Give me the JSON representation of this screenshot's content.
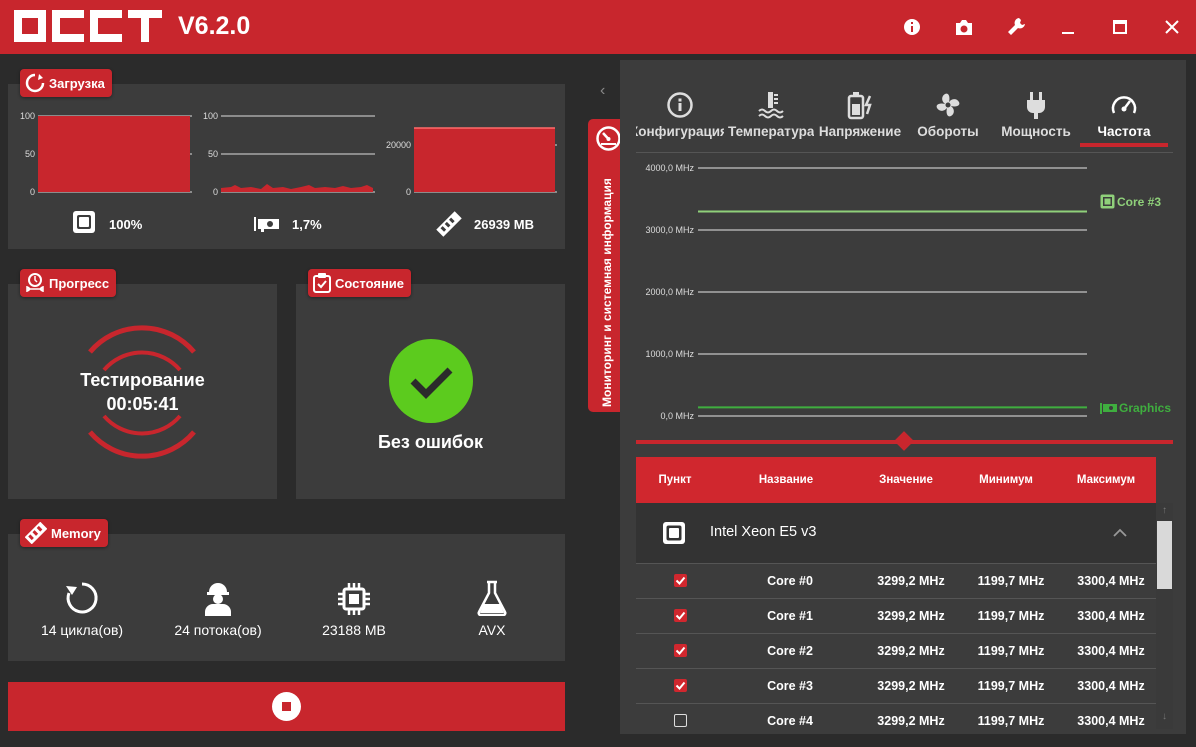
{
  "app": {
    "logo_text": "OCCT",
    "version": "V6.2.0"
  },
  "titlebar": {
    "buttons": [
      "info-icon",
      "camera-icon",
      "wrench-icon",
      "minimize-icon",
      "maximize-icon",
      "close-icon"
    ]
  },
  "load": {
    "title": "Загрузка",
    "cpu": {
      "axis": [
        "100",
        "50",
        "0"
      ],
      "value": "100%"
    },
    "gpu": {
      "axis": [
        "100",
        "50",
        "0"
      ],
      "value": "1,7%"
    },
    "memory": {
      "axis": [
        "20000",
        "0"
      ],
      "value": "26939 MB"
    }
  },
  "progress": {
    "title": "Прогресс",
    "status": "Тестирование",
    "time": "00:05:41"
  },
  "state": {
    "title": "Состояние",
    "status": "Без ошибок"
  },
  "memory": {
    "title": "Memory",
    "items": [
      {
        "icon": "loop-icon",
        "label": "14 цикла(ов)"
      },
      {
        "icon": "worker-icon",
        "label": "24 потока(ов)"
      },
      {
        "icon": "chip-icon",
        "label": "23188 MB"
      },
      {
        "icon": "flask-icon",
        "label": "AVX"
      }
    ]
  },
  "side_tab": {
    "label": "Мониторинг и системная информация"
  },
  "monitor": {
    "tabs": [
      {
        "label": "Конфигурация",
        "icon": "info-icon"
      },
      {
        "label": "Температура",
        "icon": "thermometer-icon"
      },
      {
        "label": "Напряжение",
        "icon": "battery-icon"
      },
      {
        "label": "Обороты",
        "icon": "fan-icon"
      },
      {
        "label": "Мощность",
        "icon": "plug-icon"
      },
      {
        "label": "Частота",
        "icon": "gauge-icon",
        "active": true
      }
    ],
    "chart_labels": {
      "core": "Core #3",
      "graphics": "Graphics"
    },
    "table": {
      "headers": [
        "Пункт",
        "Название",
        "Значение",
        "Минимум",
        "Максимум"
      ],
      "group": "Intel Xeon E5 v3",
      "rows": [
        {
          "checked": true,
          "name": "Core #0",
          "value": "3299,2 MHz",
          "min": "1199,7 MHz",
          "max": "3300,4 MHz"
        },
        {
          "checked": true,
          "name": "Core #1",
          "value": "3299,2 MHz",
          "min": "1199,7 MHz",
          "max": "3300,4 MHz"
        },
        {
          "checked": true,
          "name": "Core #2",
          "value": "3299,2 MHz",
          "min": "1199,7 MHz",
          "max": "3300,4 MHz"
        },
        {
          "checked": true,
          "name": "Core #3",
          "value": "3299,2 MHz",
          "min": "1199,7 MHz",
          "max": "3300,4 MHz"
        },
        {
          "checked": false,
          "name": "Core #4",
          "value": "3299,2 MHz",
          "min": "1199,7 MHz",
          "max": "3300,4 MHz"
        }
      ]
    }
  },
  "colors": {
    "accent": "#c8262d",
    "panel": "#3c3c3c",
    "ok_green": "#5ccb1e",
    "core_line": "#8fd07a",
    "graphics_line": "#3fae3f"
  },
  "chart_data": {
    "type": "line",
    "ylabel": "",
    "y_ticks": [
      "4000,0 MHz",
      "3000,0 MHz",
      "2000,0 MHz",
      "1000,0 MHz",
      "0,0 MHz"
    ],
    "ylim": [
      0,
      4000
    ],
    "series": [
      {
        "name": "Core #3",
        "values": [
          3299.2,
          3299.2
        ]
      },
      {
        "name": "Graphics",
        "values": [
          140,
          140
        ]
      }
    ]
  }
}
